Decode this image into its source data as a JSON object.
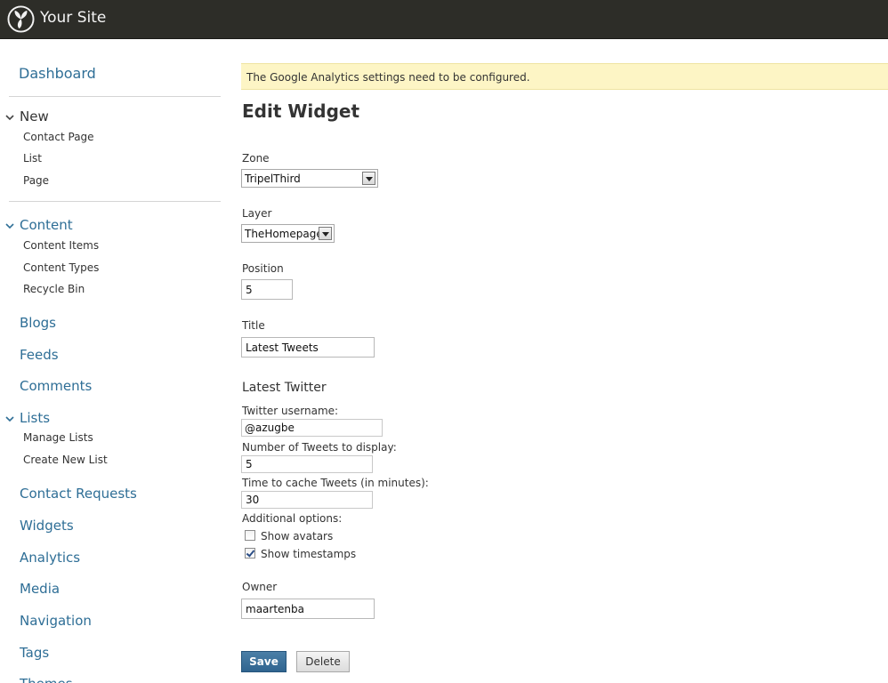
{
  "header": {
    "site_title": "Your Site",
    "logo_icon": "orchard-logo-icon"
  },
  "sidebar": {
    "dashboard": "Dashboard",
    "new": {
      "label": "New",
      "items": [
        "Contact Page",
        "List",
        "Page"
      ]
    },
    "content": {
      "label": "Content",
      "items": [
        "Content Items",
        "Content Types",
        "Recycle Bin"
      ]
    },
    "blogs": "Blogs",
    "feeds": "Feeds",
    "comments": "Comments",
    "lists": {
      "label": "Lists",
      "items": [
        "Manage Lists",
        "Create New List"
      ]
    },
    "contact_requests": "Contact Requests",
    "widgets": "Widgets",
    "analytics": "Analytics",
    "media": "Media",
    "navigation": "Navigation",
    "tags": "Tags",
    "next_partial": "Themes"
  },
  "notice": "The Google Analytics settings need to be configured.",
  "page_title": "Edit Widget",
  "form": {
    "zone": {
      "label": "Zone",
      "value": "TripelThird"
    },
    "layer": {
      "label": "Layer",
      "value": "TheHomepage"
    },
    "position": {
      "label": "Position",
      "value": "5"
    },
    "title": {
      "label": "Title",
      "value": "Latest Tweets"
    },
    "latest_twitter": {
      "heading": "Latest Twitter",
      "username_label": "Twitter username:",
      "at_symbol": "@",
      "username_value": "azugbe",
      "count_label": "Number of Tweets to display:",
      "count_value": "5",
      "cache_label": "Time to cache Tweets (in minutes):",
      "cache_value": "30",
      "options_label": "Additional options:",
      "show_avatars": {
        "label": "Show avatars",
        "checked": false
      },
      "show_timestamps": {
        "label": "Show timestamps",
        "checked": true
      }
    },
    "owner": {
      "label": "Owner",
      "value": "maartenba"
    }
  },
  "buttons": {
    "save": "Save",
    "delete": "Delete"
  },
  "colors": {
    "header_bg": "#2d2d28",
    "link": "#2e6e96",
    "notice_bg": "#fdf5c5",
    "save_button": "#3a6f99"
  }
}
